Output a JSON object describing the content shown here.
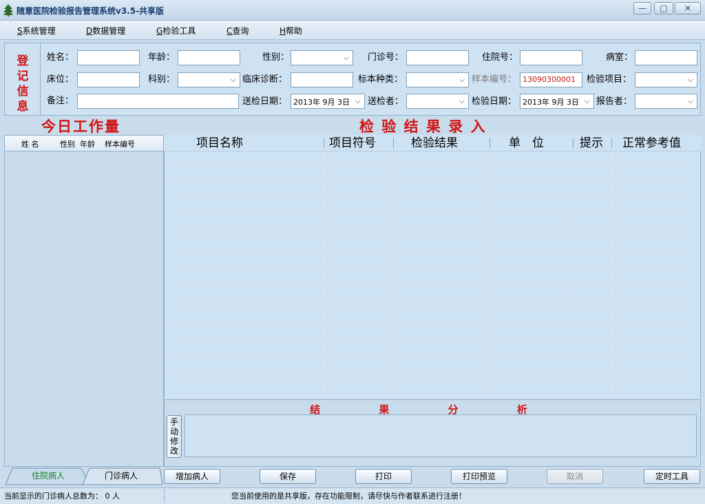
{
  "window": {
    "title": "随意医院检验报告管理系统v3.5-共享版",
    "min": "—",
    "max": "□",
    "close": "✕"
  },
  "menu": [
    {
      "key": "S",
      "label": "系统管理"
    },
    {
      "key": "D",
      "label": "数据管理"
    },
    {
      "key": "G",
      "label": "检验工具"
    },
    {
      "key": "C",
      "label": "查询"
    },
    {
      "key": "H",
      "label": "帮助"
    }
  ],
  "registration": {
    "heading": [
      "登",
      "记",
      "信",
      "息"
    ],
    "labels": {
      "name": "姓名：",
      "age": "年龄：",
      "gender": "性别：",
      "outpatient_no": "门诊号：",
      "inpatient_no": "住院号：",
      "ward": "病室：",
      "bed": "床位：",
      "department": "科别：",
      "diagnosis": "临床诊断：",
      "specimen_type": "标本种类：",
      "sample_no": "样本编号：",
      "test_item": "检验项目：",
      "remark": "备注：",
      "send_date": "送检日期：",
      "sender": "送检者：",
      "test_date": "检验日期：",
      "reporter": "报告者："
    },
    "values": {
      "sample_no": "13090300001",
      "send_date": "2013年  9月  3日",
      "test_date": "2013年  9月  3日"
    }
  },
  "sections": {
    "workload": "今日工作量",
    "entry": "检 验 结 果 录 入",
    "analysis": "结 果 分 析"
  },
  "left_list": {
    "columns": [
      "姓 名",
      "性别",
      "年龄",
      "样本编号"
    ]
  },
  "grid": {
    "columns": [
      "项目名称",
      "项目符号",
      "检验结果",
      "单　位",
      "提示",
      "正常参考值"
    ]
  },
  "manual_button": [
    "手",
    "动",
    "修",
    "改"
  ],
  "tabs": [
    "住院病人",
    "门诊病人"
  ],
  "buttons": [
    "增加病人",
    "保存",
    "打印",
    "打印预览",
    "取消",
    "定时工具"
  ],
  "status": {
    "left": "当前显示的门诊病人总数为： 0 人",
    "right": "您当前使用的是共享版，存在功能限制，请尽快与作者联系进行注册！"
  },
  "colors": {
    "accent_red": "#d01515",
    "panel_bg": "#cfe2f2"
  },
  "icons": {
    "app": "tree-icon",
    "dropdown": "chevron-down-icon"
  }
}
